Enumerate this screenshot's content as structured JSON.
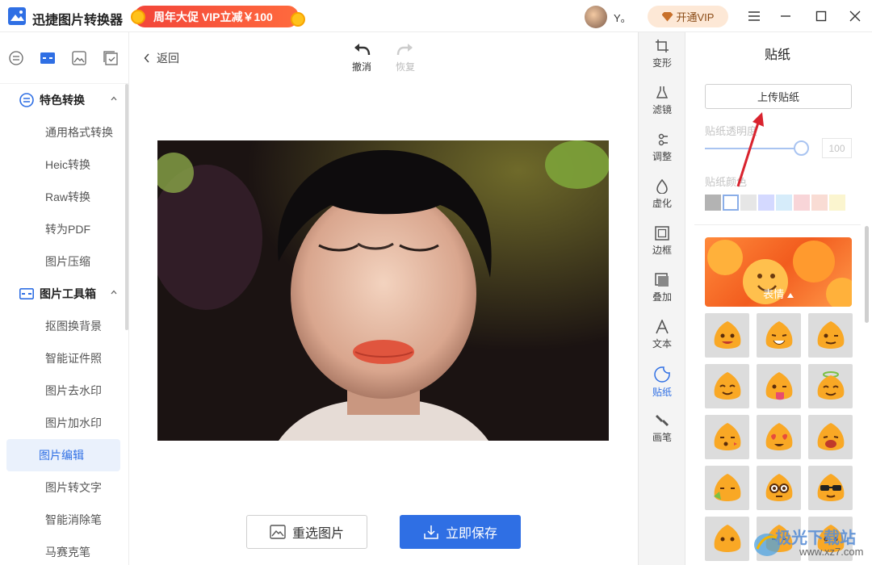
{
  "app": {
    "title": "迅捷图片转换器",
    "promo": "周年大促 VIP立减￥100",
    "user_name": "Y。",
    "vip_button": "开通VIP"
  },
  "sidebar": {
    "groups": [
      {
        "label": "特色转换",
        "items": [
          "通用格式转换",
          "Heic转换",
          "Raw转换",
          "转为PDF",
          "图片压缩"
        ]
      },
      {
        "label": "图片工具箱",
        "items": [
          "抠图换背景",
          "智能证件照",
          "图片去水印",
          "图片加水印",
          "图片编辑",
          "图片转文字",
          "智能消除笔",
          "马赛克笔"
        ]
      }
    ],
    "active_item": "图片编辑"
  },
  "main": {
    "back": "返回",
    "undo": "撤消",
    "redo": "恢复",
    "reselect": "重选图片",
    "save": "立即保存"
  },
  "tools": [
    "变形",
    "滤镜",
    "调整",
    "虚化",
    "边框",
    "叠加",
    "文本",
    "贴纸",
    "画笔"
  ],
  "active_tool": "贴纸",
  "panel": {
    "title": "贴纸",
    "upload": "上传贴纸",
    "opacity_label": "贴纸透明度",
    "opacity_value": "100",
    "opacity_level": 100,
    "color_label": "贴纸颜色",
    "swatch_colors": [
      "#b3b3b3",
      "#ffffff",
      "#e6e6e6",
      "#d4d9ff",
      "#d6ecfa",
      "#f8d5d8",
      "#f9dcd4",
      "#fbf5cf"
    ],
    "banner_label": "表情"
  },
  "watermark": {
    "brand": "极光下载站",
    "url": "www.xz7.com"
  },
  "colors": {
    "accent": "#2f6fe4",
    "promo": "#f2453a"
  }
}
